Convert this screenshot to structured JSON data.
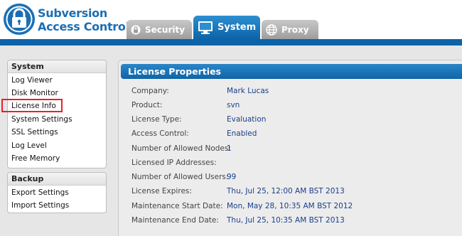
{
  "logo": {
    "line1": "Subversion",
    "line2": "Access Control"
  },
  "tabs": {
    "security": "Security",
    "system": "System",
    "proxy": "Proxy"
  },
  "sidebar": {
    "system_heading": "System",
    "system_items": [
      "Log Viewer",
      "Disk Monitor",
      "License Info",
      "System Settings",
      "SSL Settings",
      "Log Level",
      "Free Memory"
    ],
    "backup_heading": "Backup",
    "backup_items": [
      "Export Settings",
      "Import Settings"
    ]
  },
  "license": {
    "heading": "License Properties",
    "rows": [
      {
        "label": "Company:",
        "value": "Mark Lucas"
      },
      {
        "label": "Product:",
        "value": "svn"
      },
      {
        "label": "License Type:",
        "value": "Evaluation"
      },
      {
        "label": "Access Control:",
        "value": "Enabled"
      },
      {
        "label": "Number of Allowed Nodes:",
        "value": "1"
      },
      {
        "label": "Licensed IP Addresses:",
        "value": ""
      },
      {
        "label": "Number of Allowed Users:",
        "value": "99"
      },
      {
        "label": "License Expires:",
        "value": "Thu, Jul 25, 12:00 AM BST 2013"
      },
      {
        "label": "Maintenance Start Date:",
        "value": "Mon, May 28, 10:35 AM BST 2012"
      },
      {
        "label": "Maintenance End Date:",
        "value": "Thu, Jul 25, 10:35 AM BST 2013"
      }
    ]
  },
  "colors": {
    "brand": "#1a6fb4",
    "header_strip": "#0d63a8",
    "value_text": "#1b3f8b",
    "highlight": "#e8202a"
  },
  "icons": {
    "logo": "padlock-icon",
    "security_tab": "shield-icon",
    "system_tab": "monitor-icon",
    "proxy_tab": "globe-icon"
  }
}
